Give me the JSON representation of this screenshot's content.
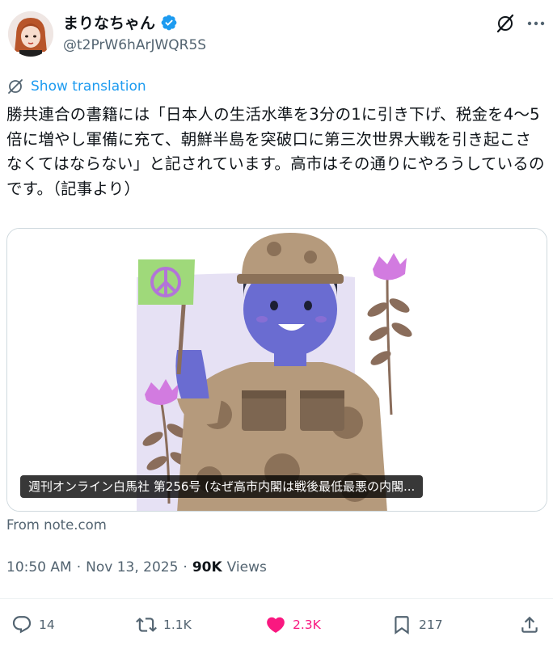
{
  "author": {
    "display_name": "まりなちゃん",
    "handle": "@t2PrW6hArJWQR5S",
    "verified": true
  },
  "header_icons": [
    "grok-icon",
    "more-icon"
  ],
  "translation": {
    "label": "Show translation"
  },
  "tweet": {
    "text": "勝共連合の書籍には「日本人の生活水準を3分の1に引き下げ、税金を4〜5倍に増やし軍備に充て、朝鮮半島を突破口に第三次世界大戦を引き起こさなくてはならない」と記されています。高市はその通りにやろうしているのです。（記事より）"
  },
  "link_card": {
    "caption": "週刊オンライン白馬社 第256号 (なぜ高市内閣は戦後最低最悪の内閣...",
    "source": "From note.com"
  },
  "meta": {
    "time": "10:50 AM",
    "sep1": "·",
    "date": "Nov 13, 2025",
    "sep2": "·",
    "views_count": "90K",
    "views_label": "Views"
  },
  "actions": {
    "reply_count": "14",
    "repost_count": "1.1K",
    "like_count": "2.3K",
    "bookmark_count": "217"
  },
  "colors": {
    "accent": "#1d9bf0",
    "like": "#f91880",
    "muted": "#536471",
    "text": "#0f1419"
  }
}
